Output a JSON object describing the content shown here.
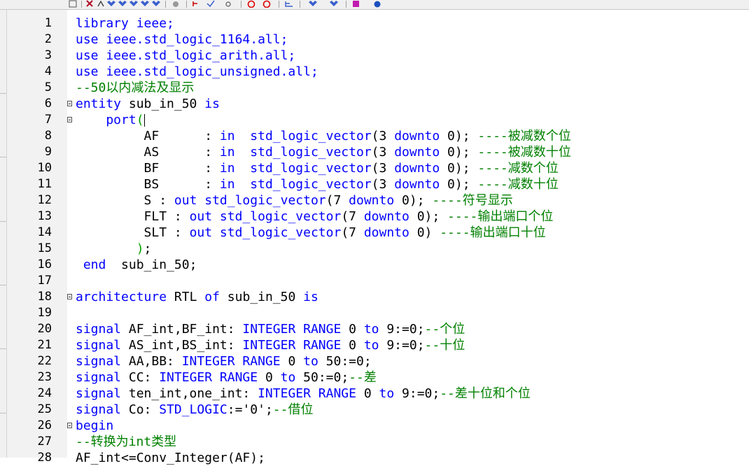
{
  "editor": {
    "lines": [
      {
        "n": "1",
        "fold": false,
        "segs": [
          {
            "t": "library ieee;",
            "c": "k"
          }
        ]
      },
      {
        "n": "2",
        "fold": false,
        "segs": [
          {
            "t": "use ieee.std_logic_1164.all;",
            "c": "k"
          }
        ]
      },
      {
        "n": "3",
        "fold": false,
        "segs": [
          {
            "t": "use ieee.std_logic_arith.all;",
            "c": "k"
          }
        ]
      },
      {
        "n": "4",
        "fold": false,
        "segs": [
          {
            "t": "use ieee.std_logic_unsigned.all;",
            "c": "k"
          }
        ]
      },
      {
        "n": "5",
        "fold": false,
        "segs": [
          {
            "t": "--50以内减法及显示",
            "c": "c"
          }
        ]
      },
      {
        "n": "6",
        "fold": true,
        "segs": [
          {
            "t": "entity ",
            "c": "k"
          },
          {
            "t": "sub_in_50 ",
            "c": "g"
          },
          {
            "t": "is",
            "c": "k"
          }
        ]
      },
      {
        "n": "7",
        "fold": true,
        "segs": [
          {
            "t": "    port",
            "c": "k"
          },
          {
            "t": "(",
            "c": "p"
          }
        ]
      },
      {
        "n": "8",
        "fold": false,
        "segs": [
          {
            "t": "         AF      : ",
            "c": "g"
          },
          {
            "t": "in",
            "c": "k"
          },
          {
            "t": "  std_logic_vector",
            "c": "k"
          },
          {
            "t": "(3 ",
            "c": "g"
          },
          {
            "t": "downto",
            "c": "k"
          },
          {
            "t": " 0); ",
            "c": "g"
          },
          {
            "t": "----被减数个位",
            "c": "c"
          }
        ]
      },
      {
        "n": "9",
        "fold": false,
        "segs": [
          {
            "t": "         AS      : ",
            "c": "g"
          },
          {
            "t": "in",
            "c": "k"
          },
          {
            "t": "  std_logic_vector",
            "c": "k"
          },
          {
            "t": "(3 ",
            "c": "g"
          },
          {
            "t": "downto",
            "c": "k"
          },
          {
            "t": " 0); ",
            "c": "g"
          },
          {
            "t": "----被减数十位",
            "c": "c"
          }
        ]
      },
      {
        "n": "10",
        "fold": false,
        "segs": [
          {
            "t": "         BF      : ",
            "c": "g"
          },
          {
            "t": "in",
            "c": "k"
          },
          {
            "t": "  std_logic_vector",
            "c": "k"
          },
          {
            "t": "(3 ",
            "c": "g"
          },
          {
            "t": "downto",
            "c": "k"
          },
          {
            "t": " 0); ",
            "c": "g"
          },
          {
            "t": "----减数个位",
            "c": "c"
          }
        ]
      },
      {
        "n": "11",
        "fold": false,
        "segs": [
          {
            "t": "         BS      : ",
            "c": "g"
          },
          {
            "t": "in",
            "c": "k"
          },
          {
            "t": "  std_logic_vector",
            "c": "k"
          },
          {
            "t": "(3 ",
            "c": "g"
          },
          {
            "t": "downto",
            "c": "k"
          },
          {
            "t": " 0); ",
            "c": "g"
          },
          {
            "t": "----减数十位",
            "c": "c"
          }
        ]
      },
      {
        "n": "12",
        "fold": false,
        "segs": [
          {
            "t": "         S : ",
            "c": "g"
          },
          {
            "t": "out",
            "c": "k"
          },
          {
            "t": " std_logic_vector",
            "c": "k"
          },
          {
            "t": "(7 ",
            "c": "g"
          },
          {
            "t": "downto",
            "c": "k"
          },
          {
            "t": " 0); ",
            "c": "g"
          },
          {
            "t": "----符号显示",
            "c": "c"
          }
        ]
      },
      {
        "n": "13",
        "fold": false,
        "segs": [
          {
            "t": "         FLT : ",
            "c": "g"
          },
          {
            "t": "out",
            "c": "k"
          },
          {
            "t": " std_logic_vector",
            "c": "k"
          },
          {
            "t": "(7 ",
            "c": "g"
          },
          {
            "t": "downto",
            "c": "k"
          },
          {
            "t": " 0); ",
            "c": "g"
          },
          {
            "t": "----输出端口个位",
            "c": "c"
          }
        ]
      },
      {
        "n": "14",
        "fold": false,
        "segs": [
          {
            "t": "         SLT : ",
            "c": "g"
          },
          {
            "t": "out",
            "c": "k"
          },
          {
            "t": " std_logic_vector",
            "c": "k"
          },
          {
            "t": "(7 ",
            "c": "g"
          },
          {
            "t": "downto",
            "c": "k"
          },
          {
            "t": " 0) ",
            "c": "g"
          },
          {
            "t": "----输出端口十位",
            "c": "c"
          }
        ]
      },
      {
        "n": "15",
        "fold": false,
        "segs": [
          {
            "t": "        ",
            "c": "g"
          },
          {
            "t": ")",
            "c": "p"
          },
          {
            "t": ";",
            "c": "g"
          }
        ]
      },
      {
        "n": "16",
        "fold": false,
        "segs": [
          {
            "t": " end",
            "c": "k"
          },
          {
            "t": "  sub_in_50;",
            "c": "g"
          }
        ]
      },
      {
        "n": "17",
        "fold": false,
        "segs": []
      },
      {
        "n": "18",
        "fold": true,
        "segs": [
          {
            "t": "architecture ",
            "c": "k"
          },
          {
            "t": "RTL ",
            "c": "g"
          },
          {
            "t": "of ",
            "c": "k"
          },
          {
            "t": "sub_in_50 ",
            "c": "g"
          },
          {
            "t": "is",
            "c": "k"
          }
        ]
      },
      {
        "n": "19",
        "fold": false,
        "segs": []
      },
      {
        "n": "20",
        "fold": false,
        "segs": [
          {
            "t": "signal ",
            "c": "k"
          },
          {
            "t": "AF_int,BF_int: ",
            "c": "g"
          },
          {
            "t": "INTEGER RANGE ",
            "c": "k"
          },
          {
            "t": "0 ",
            "c": "g"
          },
          {
            "t": "to ",
            "c": "k"
          },
          {
            "t": "9:=0;",
            "c": "g"
          },
          {
            "t": "--个位",
            "c": "c"
          }
        ]
      },
      {
        "n": "21",
        "fold": false,
        "segs": [
          {
            "t": "signal ",
            "c": "k"
          },
          {
            "t": "AS_int,BS_int: ",
            "c": "g"
          },
          {
            "t": "INTEGER RANGE ",
            "c": "k"
          },
          {
            "t": "0 ",
            "c": "g"
          },
          {
            "t": "to ",
            "c": "k"
          },
          {
            "t": "9:=0;",
            "c": "g"
          },
          {
            "t": "--十位",
            "c": "c"
          }
        ]
      },
      {
        "n": "22",
        "fold": false,
        "segs": [
          {
            "t": "signal ",
            "c": "k"
          },
          {
            "t": "AA,BB: ",
            "c": "g"
          },
          {
            "t": "INTEGER RANGE ",
            "c": "k"
          },
          {
            "t": "0 ",
            "c": "g"
          },
          {
            "t": "to ",
            "c": "k"
          },
          {
            "t": "50:=0;",
            "c": "g"
          }
        ]
      },
      {
        "n": "23",
        "fold": false,
        "segs": [
          {
            "t": "signal ",
            "c": "k"
          },
          {
            "t": "CC: ",
            "c": "g"
          },
          {
            "t": "INTEGER RANGE ",
            "c": "k"
          },
          {
            "t": "0 ",
            "c": "g"
          },
          {
            "t": "to ",
            "c": "k"
          },
          {
            "t": "50:=0;",
            "c": "g"
          },
          {
            "t": "--差",
            "c": "c"
          }
        ]
      },
      {
        "n": "24",
        "fold": false,
        "segs": [
          {
            "t": "signal ",
            "c": "k"
          },
          {
            "t": "ten_int,one_int: ",
            "c": "g"
          },
          {
            "t": "INTEGER RANGE ",
            "c": "k"
          },
          {
            "t": "0 ",
            "c": "g"
          },
          {
            "t": "to ",
            "c": "k"
          },
          {
            "t": "9:=0;",
            "c": "g"
          },
          {
            "t": "--差十位和个位",
            "c": "c"
          }
        ]
      },
      {
        "n": "25",
        "fold": false,
        "segs": [
          {
            "t": "signal ",
            "c": "k"
          },
          {
            "t": "Co: ",
            "c": "g"
          },
          {
            "t": "STD_LOGIC",
            "c": "k"
          },
          {
            "t": ":='0';",
            "c": "g"
          },
          {
            "t": "--借位",
            "c": "c"
          }
        ]
      },
      {
        "n": "26",
        "fold": true,
        "segs": [
          {
            "t": "begin",
            "c": "k"
          }
        ]
      },
      {
        "n": "27",
        "fold": false,
        "segs": [
          {
            "t": "--转换为int类型",
            "c": "c"
          }
        ]
      },
      {
        "n": "28",
        "fold": false,
        "segs": [
          {
            "t": "AF_int<=Conv_Integer(AF);",
            "c": "g"
          }
        ]
      }
    ]
  }
}
